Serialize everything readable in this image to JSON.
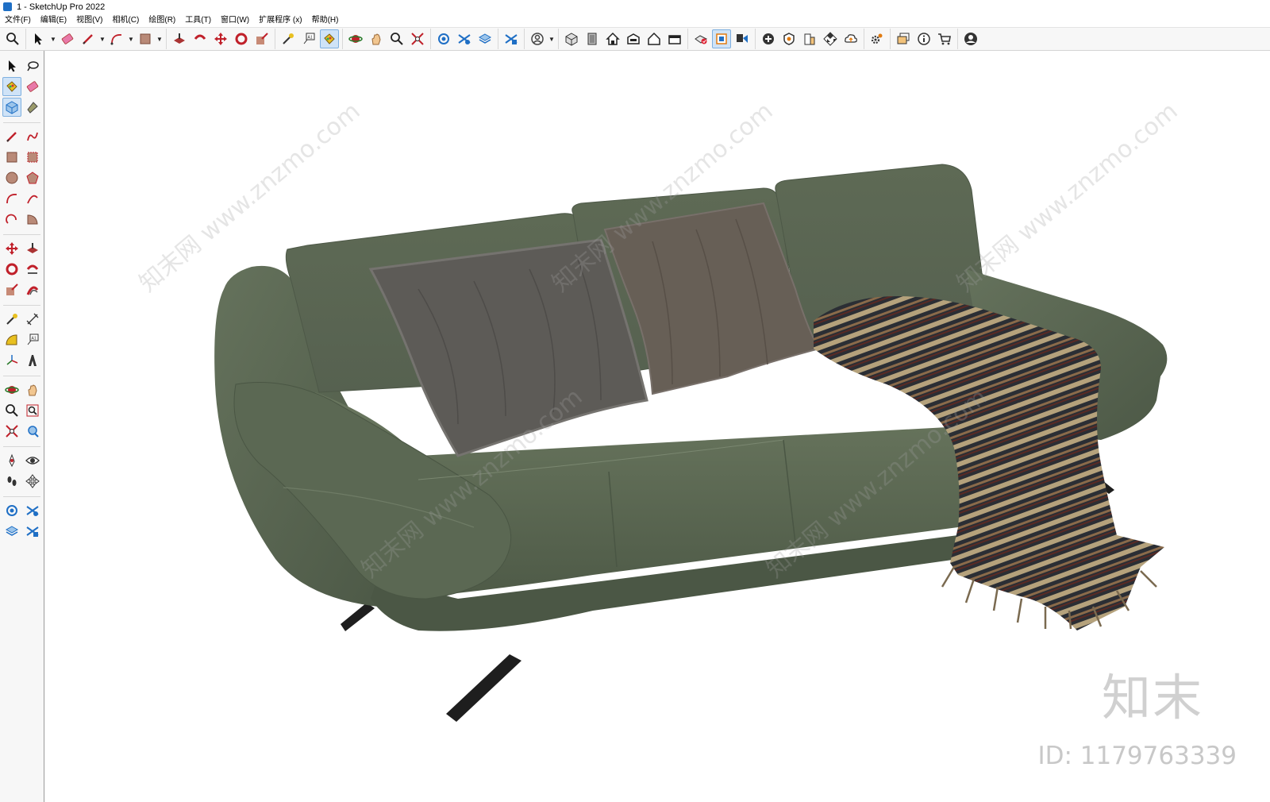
{
  "window": {
    "title": "1 - SketchUp Pro 2022"
  },
  "menu": [
    "文件(F)",
    "编辑(E)",
    "视图(V)",
    "相机(C)",
    "绘图(R)",
    "工具(T)",
    "窗口(W)",
    "扩展程序 (x)",
    "帮助(H)"
  ],
  "colors": {
    "sofa": "#5d6a55",
    "sofa_dark": "#4a5644",
    "sofa_light": "#6f7c66",
    "pillow_left": "#5f5d59",
    "pillow_right": "#6b6259",
    "throw_dark": "#2a2d33",
    "throw_light": "#b3a07a",
    "legs": "#1e1e1e",
    "accent": "#1f6fc5"
  },
  "watermark": {
    "brand": "知末",
    "id_text": "ID: 1179763339",
    "pattern": "知末网 www.znzmo.com"
  }
}
